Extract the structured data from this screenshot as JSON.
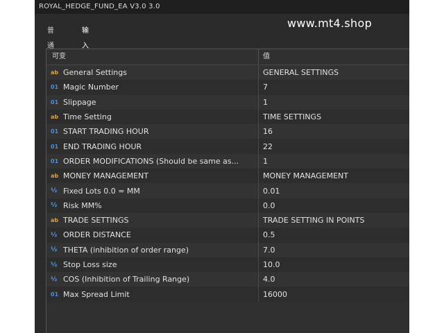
{
  "window": {
    "title": "ROYAL_HEDGE_FUND_EA V3.0 3.0"
  },
  "tabs": [
    {
      "label": "普通"
    },
    {
      "label": "输入"
    }
  ],
  "watermark": "www.mt4.shop",
  "columns": {
    "variable": "可变",
    "value": "值"
  },
  "rows": [
    {
      "icon": "ab",
      "name": "General Settings",
      "value": "GENERAL SETTINGS"
    },
    {
      "icon": "01",
      "name": "Magic Number",
      "value": "7"
    },
    {
      "icon": "01",
      "name": "Slippage",
      "value": "1"
    },
    {
      "icon": "ab",
      "name": "Time Setting",
      "value": "TIME SETTINGS"
    },
    {
      "icon": "01",
      "name": "START TRADING HOUR",
      "value": "16"
    },
    {
      "icon": "01",
      "name": "END TRADING HOUR",
      "value": "22"
    },
    {
      "icon": "01",
      "name": "ORDER MODIFICATIONS (Should be same as...",
      "value": "1"
    },
    {
      "icon": "ab",
      "name": "MONEY MANAGEMENT",
      "value": "MONEY MANAGEMENT"
    },
    {
      "icon": "½",
      "name": "Fixed Lots 0.0 = MM",
      "value": "0.01"
    },
    {
      "icon": "½",
      "name": "Risk MM%",
      "value": "0.0"
    },
    {
      "icon": "ab",
      "name": "TRADE SETTINGS",
      "value": "TRADE SETTING IN POINTS"
    },
    {
      "icon": "½",
      "name": "ORDER DISTANCE",
      "value": "0.5"
    },
    {
      "icon": "½",
      "name": "THETA (inhibition of order range)",
      "value": "7.0"
    },
    {
      "icon": "½",
      "name": "Stop Loss size",
      "value": "10.0"
    },
    {
      "icon": "½",
      "name": "COS (Inhibition of Trailing Range)",
      "value": "4.0"
    },
    {
      "icon": "01",
      "name": "Max Spread Limit",
      "value": "16000"
    }
  ]
}
